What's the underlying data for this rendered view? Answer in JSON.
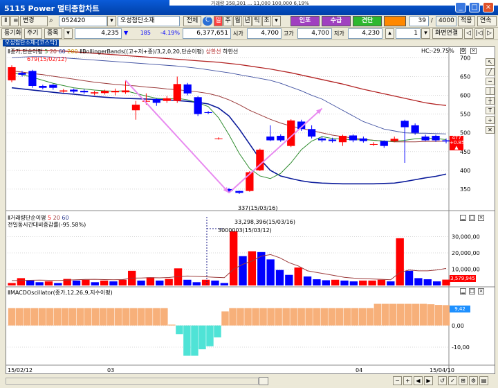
{
  "window": {
    "title": "5115 Power 멀티종합차트",
    "background_strip": "거래량    358,301    ...  11,000  100,000  6,19%"
  },
  "toolbar1": {
    "search_label": "변경",
    "code": "052420",
    "stock_name": "오성첨단소재",
    "btn_all": "전체",
    "mode_labels": [
      "일",
      "주",
      "월",
      "년",
      "틱",
      "초"
    ],
    "btn_indicator": "인포",
    "btn_order": "수급",
    "btn_execute": "견단",
    "count": "39",
    "total": "4000",
    "label_apply": "적용",
    "label_continuous": "연속"
  },
  "toolbar2": {
    "btn_period": "등기화",
    "btn_week": "주기",
    "btn_type": "종목",
    "price": "4,235",
    "arrow": "▼",
    "change": "185",
    "change_pct": "-4.19%",
    "volume": "6,377,651",
    "open_label": "시가",
    "open": "4,700",
    "high_label": "고가",
    "high": "4,700",
    "low_label": "저가",
    "low": "4,230",
    "page": "1",
    "btn_screen": "화면연결"
  },
  "tab": {
    "label": "오성첨단소재-[코스닥]"
  },
  "colors": {
    "up": "#ff0000",
    "down": "#0000ff",
    "ma5": "#2e8b2e",
    "ma20": "#9b3a3a",
    "ma60": "#2a3a8f",
    "bb": "#b22222",
    "bb_low": "#0a1a9a",
    "arrow": "#e88af0",
    "macd_pos": "#f7b07a",
    "macd_neg": "#4fe3d6"
  },
  "chart_data": [
    {
      "type": "candlestick",
      "name": "price",
      "legend": {
        "ma": "Ⅱ종가,단순이평",
        "periods": [
          "5",
          "20",
          "60",
          "200"
        ],
        "bb": "ⅡBollingerBands((고+저+종)/3,2,0,20,단순이평)",
        "limit_up": "상한선",
        "limit_down": "하한선"
      },
      "hc_label": "HC:-29.75%",
      "ylim": [
        300,
        710
      ],
      "yticks": [
        "700",
        "650",
        "600",
        "550",
        "500",
        "450",
        "400",
        "350"
      ],
      "current_price": "477",
      "current_change": "+0.85%",
      "current_arrow": "▲",
      "annotations": {
        "high": "679(15/02/12)",
        "low": "337(15/03/16)"
      },
      "candles": [
        {
          "o": 640,
          "c": 675,
          "h": 680,
          "l": 635
        },
        {
          "o": 660,
          "c": 655,
          "h": 665,
          "l": 650
        },
        {
          "o": 665,
          "c": 625,
          "h": 668,
          "l": 620
        },
        {
          "o": 625,
          "c": 620,
          "h": 628,
          "l": 616
        },
        {
          "o": 628,
          "c": 620,
          "h": 630,
          "l": 615
        },
        {
          "o": 610,
          "c": 613,
          "h": 617,
          "l": 607
        },
        {
          "o": 615,
          "c": 610,
          "h": 618,
          "l": 606
        },
        {
          "o": 612,
          "c": 608,
          "h": 616,
          "l": 604
        },
        {
          "o": 605,
          "c": 608,
          "h": 612,
          "l": 600
        },
        {
          "o": 606,
          "c": 612,
          "h": 615,
          "l": 602
        },
        {
          "o": 608,
          "c": 612,
          "h": 618,
          "l": 600
        },
        {
          "o": 608,
          "c": 613,
          "h": 640,
          "l": 604
        },
        {
          "o": 560,
          "c": 575,
          "h": 585,
          "l": 535
        },
        {
          "o": 585,
          "c": 585,
          "h": 605,
          "l": 575
        },
        {
          "o": 590,
          "c": 580,
          "h": 592,
          "l": 572
        },
        {
          "o": 585,
          "c": 592,
          "h": 598,
          "l": 580
        },
        {
          "o": 585,
          "c": 630,
          "h": 650,
          "l": 580
        },
        {
          "o": 629,
          "c": 605,
          "h": 633,
          "l": 600
        },
        {
          "o": 595,
          "c": 550,
          "h": 598,
          "l": 545
        },
        {
          "o": 555,
          "c": 553,
          "h": 558,
          "l": 550
        },
        {
          "o": 485,
          "c": 485,
          "h": 488,
          "l": 482
        },
        {
          "o": 350,
          "c": 345,
          "h": 353,
          "l": 342
        },
        {
          "o": 345,
          "c": 340,
          "h": 346,
          "l": 337
        },
        {
          "o": 345,
          "c": 395,
          "h": 398,
          "l": 343
        },
        {
          "o": 400,
          "c": 455,
          "h": 458,
          "l": 398
        },
        {
          "o": 490,
          "c": 480,
          "h": 520,
          "l": 478
        },
        {
          "o": 492,
          "c": 480,
          "h": 496,
          "l": 476
        },
        {
          "o": 465,
          "c": 533,
          "h": 536,
          "l": 462
        },
        {
          "o": 530,
          "c": 510,
          "h": 535,
          "l": 505
        },
        {
          "o": 510,
          "c": 490,
          "h": 520,
          "l": 485
        },
        {
          "o": 485,
          "c": 480,
          "h": 490,
          "l": 475
        },
        {
          "o": 482,
          "c": 478,
          "h": 487,
          "l": 474
        },
        {
          "o": 475,
          "c": 492,
          "h": 495,
          "l": 465
        },
        {
          "o": 493,
          "c": 480,
          "h": 496,
          "l": 475
        },
        {
          "o": 485,
          "c": 478,
          "h": 490,
          "l": 474
        },
        {
          "o": 470,
          "c": 470,
          "h": 475,
          "l": 465
        },
        {
          "o": 478,
          "c": 465,
          "h": 480,
          "l": 460
        },
        {
          "o": 478,
          "c": 484,
          "h": 490,
          "l": 475
        },
        {
          "o": 532,
          "c": 515,
          "h": 535,
          "l": 420
        },
        {
          "o": 520,
          "c": 500,
          "h": 525,
          "l": 495
        },
        {
          "o": 490,
          "c": 480,
          "h": 495,
          "l": 478
        },
        {
          "o": 492,
          "c": 480,
          "h": 495,
          "l": 476
        },
        {
          "o": 480,
          "c": 477,
          "h": 485,
          "l": 472
        }
      ],
      "ma5": [
        660,
        655,
        648,
        640,
        632,
        626,
        620,
        617,
        614,
        612,
        611,
        612,
        605,
        598,
        592,
        590,
        592,
        588,
        580,
        570,
        540,
        495,
        445,
        405,
        385,
        378,
        392,
        420,
        455,
        478,
        490,
        485,
        483,
        481,
        482,
        480,
        478,
        477,
        480,
        484,
        486,
        485,
        482
      ],
      "ma20": [
        665,
        662,
        658,
        655,
        651,
        647,
        643,
        639,
        635,
        632,
        629,
        627,
        625,
        622,
        620,
        617,
        615,
        612,
        609,
        605,
        598,
        588,
        575,
        560,
        548,
        536,
        526,
        518,
        512,
        506,
        500,
        494,
        490,
        486,
        483,
        480,
        478,
        476,
        476,
        476,
        477,
        477,
        478
      ],
      "ma60": [
        620,
        617,
        614,
        611,
        608,
        605,
        603,
        600,
        597,
        595,
        593,
        592,
        591,
        590,
        589,
        588,
        586,
        584,
        581,
        577,
        566,
        545,
        510,
        470,
        430,
        400,
        385,
        378,
        372,
        368,
        366,
        365,
        364,
        364,
        364,
        364,
        365,
        366,
        370,
        375,
        380,
        384,
        390
      ],
      "bb_upper": [
        700,
        702,
        703,
        703,
        702,
        700,
        698,
        696,
        694,
        692,
        690,
        688,
        686,
        684,
        682,
        680,
        678,
        675,
        672,
        668,
        664,
        660,
        655,
        650,
        645,
        640,
        632,
        622,
        612,
        600,
        590,
        575,
        560,
        545,
        530,
        520,
        510,
        505,
        500,
        499,
        499,
        498,
        497
      ],
      "bb_upper2": [
        720,
        720,
        720,
        720,
        719,
        718,
        716,
        714,
        712,
        710,
        708,
        706,
        704,
        702,
        700,
        698,
        696,
        694,
        692,
        690,
        688,
        685,
        682,
        678,
        674,
        670,
        665,
        660,
        654,
        648,
        642,
        636,
        630,
        623,
        616,
        610,
        604,
        598,
        592,
        586,
        580,
        576,
        573
      ],
      "arrows": [
        {
          "from": [
            11,
            640
          ],
          "to": [
            21,
            340
          ]
        },
        {
          "from": [
            21,
            340
          ],
          "to": [
            30,
            565
          ]
        }
      ]
    },
    {
      "type": "bar",
      "name": "volume",
      "legend": "Ⅱ거래량단순이평",
      "periods": [
        "5",
        "20",
        "60"
      ],
      "legend2": "전일동시간대비증감률(-95.58%)",
      "ylim": [
        0,
        40000000
      ],
      "yticks": [
        "30,000,00",
        "20,000,00",
        "10,000,00"
      ],
      "current_value": "3,579,945",
      "annotations": {
        "high": "33,298,396(15/03/16)",
        "cross": "3000003(15/03/12)"
      },
      "values": [
        1500000,
        4500000,
        3000000,
        2000000,
        2500000,
        1500000,
        4000000,
        3000000,
        3500000,
        2000000,
        3000000,
        2500000,
        3500000,
        9000000,
        3000000,
        5000000,
        3000000,
        4000000,
        10500000,
        3500000,
        2000000,
        3500000,
        3000000,
        1500000,
        33298396,
        18000000,
        21000000,
        20500000,
        16000000,
        9500000,
        6500000,
        11000000,
        5500000,
        3800000,
        3200000,
        3500000,
        3000000,
        2500000,
        3000000,
        3000000,
        3500000,
        2500000,
        29000000,
        9000000,
        4500000,
        3800000,
        2500000,
        3579945
      ],
      "ma": [
        3000000,
        3100000,
        3200000,
        3300000,
        3200000,
        3100000,
        3300000,
        3500000,
        3700000,
        3800000,
        3600000,
        3500000,
        3600000,
        4500000,
        4600000,
        4800000,
        4700000,
        4900000,
        5500000,
        5800000,
        5600000,
        5300000,
        5000000,
        4800000,
        10000000,
        13000000,
        15000000,
        18000000,
        19000000,
        17000000,
        14000000,
        12000000,
        9000000,
        8000000,
        7000000,
        6000000,
        5000000,
        4500000,
        4200000,
        4000000,
        3800000,
        3500000,
        8000000,
        9500000,
        9000000,
        9000000,
        9500000,
        10500000
      ]
    },
    {
      "type": "bar",
      "name": "macd",
      "legend": "ⅡMACDOscillator(종가,12,26,9,지수이평)",
      "ylim": [
        -18,
        14
      ],
      "yticks": [
        "0,00",
        "-10,00"
      ],
      "current_value": "9,42",
      "values": [
        8,
        8,
        8,
        8,
        8,
        8,
        8,
        8,
        8,
        8,
        8,
        8,
        8,
        8,
        8,
        8,
        8,
        8,
        8,
        8,
        8,
        0.4,
        -4,
        -14,
        -14,
        -11,
        -9.6,
        -5.5,
        6.5,
        8,
        8,
        8,
        8,
        8,
        8,
        8,
        8,
        8,
        8,
        8,
        8,
        8,
        8,
        8,
        8,
        8,
        8,
        8,
        10,
        10,
        10,
        10,
        10,
        10,
        10,
        9.8,
        9.5,
        9.4
      ],
      "x_labels": [
        "15/02/12",
        "03",
        "04",
        "15/04/10"
      ]
    }
  ]
}
